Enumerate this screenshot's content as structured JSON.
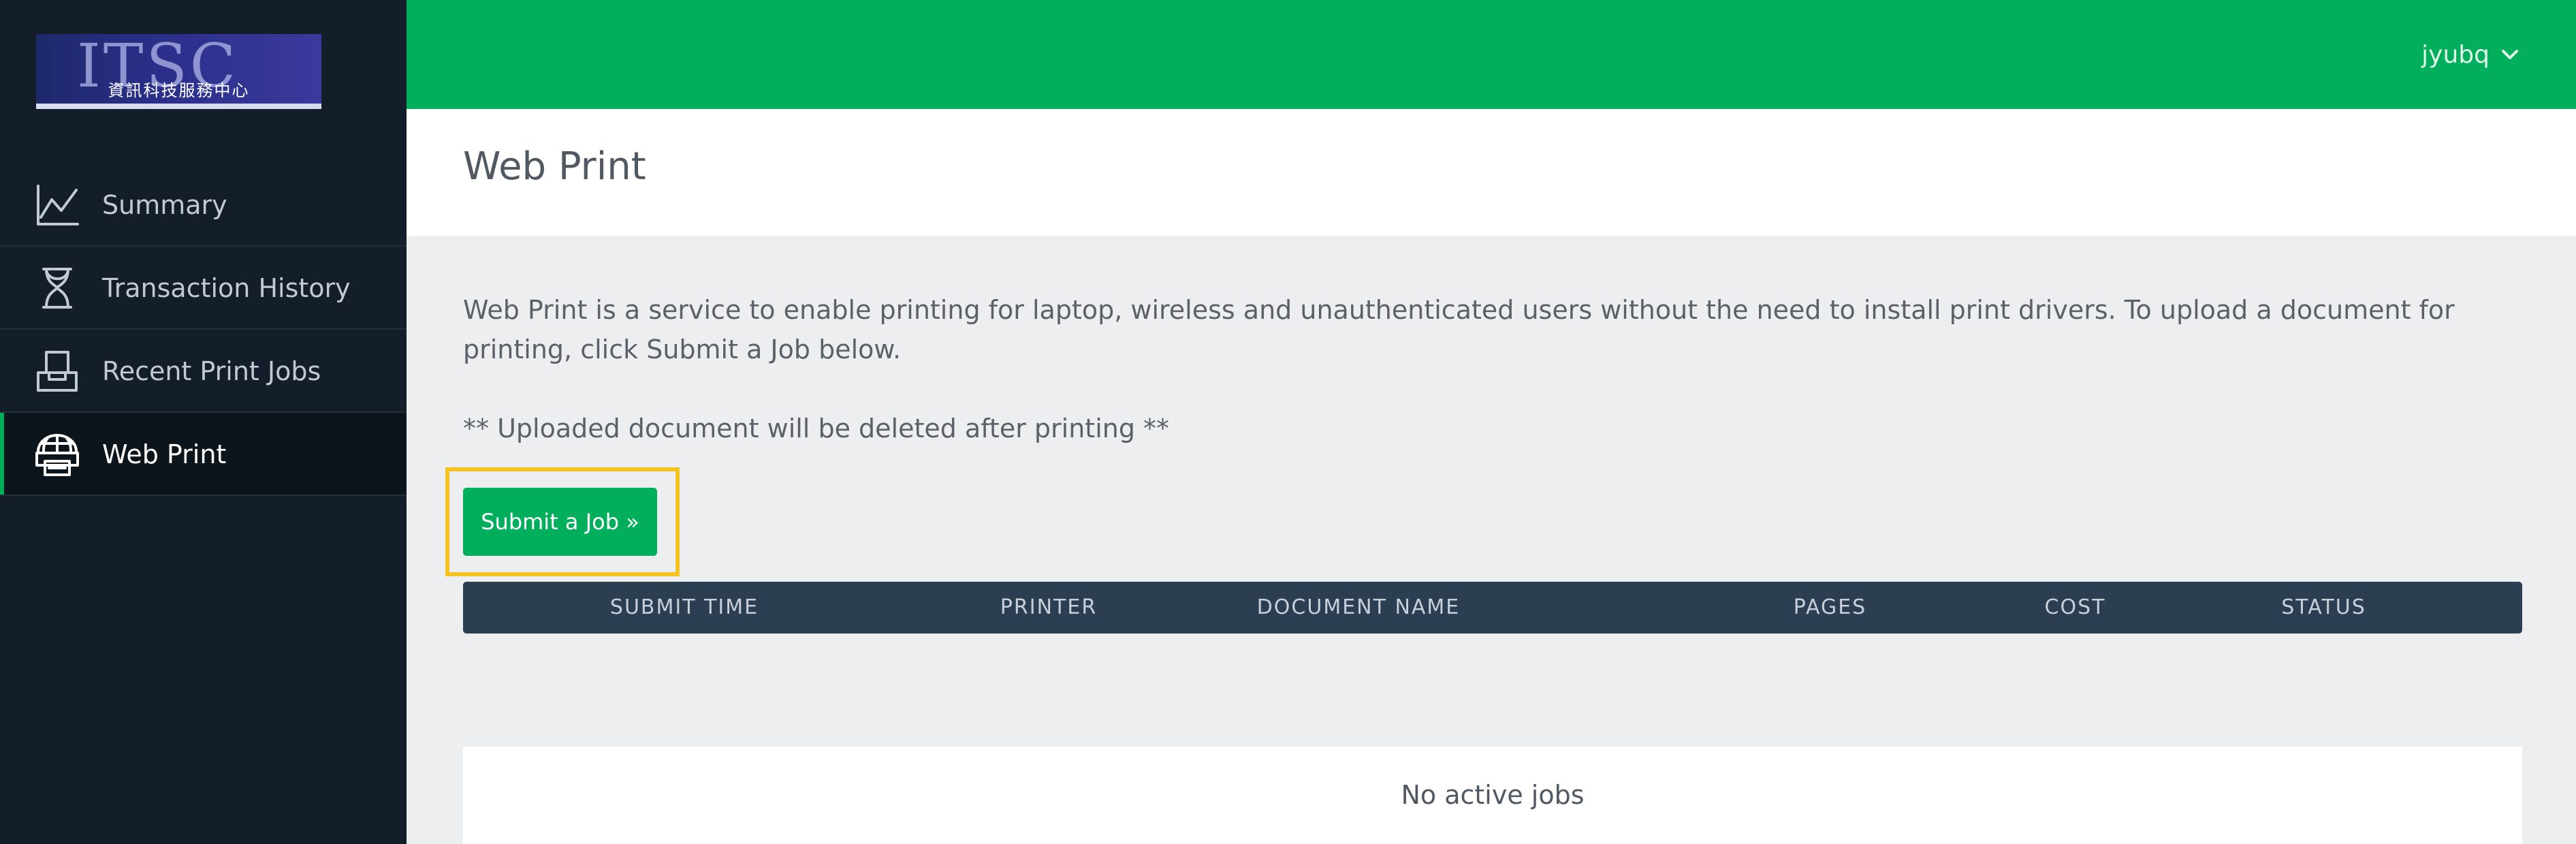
{
  "logo": {
    "text": "ITSC",
    "subtitle": "資訊科技服務中心"
  },
  "sidebar": {
    "items": [
      {
        "label": "Summary",
        "icon": "chart-line-icon",
        "active": false
      },
      {
        "label": "Transaction History",
        "icon": "hourglass-icon",
        "active": false
      },
      {
        "label": "Recent Print Jobs",
        "icon": "inbox-tray-icon",
        "active": false
      },
      {
        "label": "Web Print",
        "icon": "globe-printer-icon",
        "active": true
      }
    ]
  },
  "header": {
    "user_name": "jyubq",
    "user_menu_icon": "chevron-down-icon"
  },
  "page": {
    "title": "Web Print",
    "intro": "Web Print is a service to enable printing for laptop, wireless and unauthenticated users without the need to install print drivers. To upload a document for printing, click Submit a Job below.",
    "note": "** Uploaded document will be deleted after printing **",
    "submit_label": "Submit a Job »"
  },
  "table": {
    "columns": [
      "SUBMIT TIME",
      "PRINTER",
      "DOCUMENT NAME",
      "PAGES",
      "COST",
      "STATUS"
    ],
    "empty_message": "No active jobs"
  },
  "colors": {
    "accent": "#00ae5c",
    "sidebar": "#131e2a",
    "table_header": "#2c3e52",
    "highlight": "#f5c224"
  }
}
